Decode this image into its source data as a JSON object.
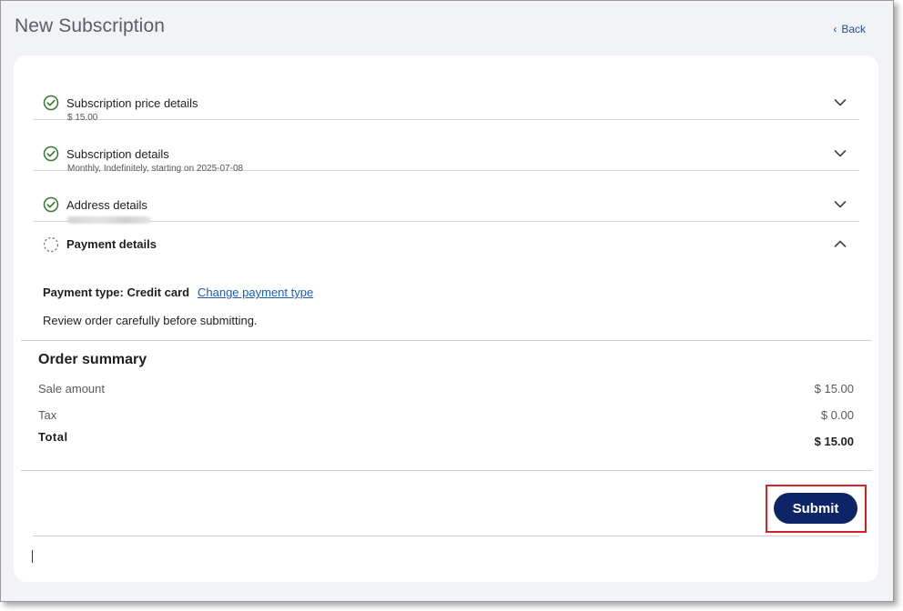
{
  "page": {
    "title": "New Subscription",
    "back_label": "Back"
  },
  "sections": [
    {
      "title": "Subscription price details",
      "subtitle": "$ 15.00",
      "status": "complete",
      "expanded": false
    },
    {
      "title": "Subscription details",
      "subtitle": "Monthly, Indefinitely, starting on 2025-07-08",
      "status": "complete",
      "expanded": false
    },
    {
      "title": "Address details",
      "subtitle": "",
      "status": "complete",
      "expanded": false
    }
  ],
  "payment": {
    "title": "Payment details",
    "status": "in-progress",
    "expanded": true,
    "type_label": "Payment type: Credit card",
    "change_label": "Change payment type",
    "review_note": "Review order carefully before submitting."
  },
  "order_summary": {
    "title": "Order summary",
    "sale_label": "Sale amount",
    "sale_value": "$ 15.00",
    "tax_label": "Tax",
    "tax_value": "$ 0.00",
    "total_label": "Total",
    "total_value": "$ 15.00"
  },
  "actions": {
    "submit_label": "Submit"
  },
  "colors": {
    "check_green": "#2e7d32",
    "primary_navy": "#0d2466",
    "link_blue": "#1a5fb4",
    "highlight_red": "#d6202a"
  },
  "icons": {
    "complete": "check-circle-icon",
    "in_progress": "dashed-circle-icon",
    "collapsed": "chevron-down-icon",
    "expanded": "chevron-up-icon",
    "back": "chevron-left-icon"
  }
}
